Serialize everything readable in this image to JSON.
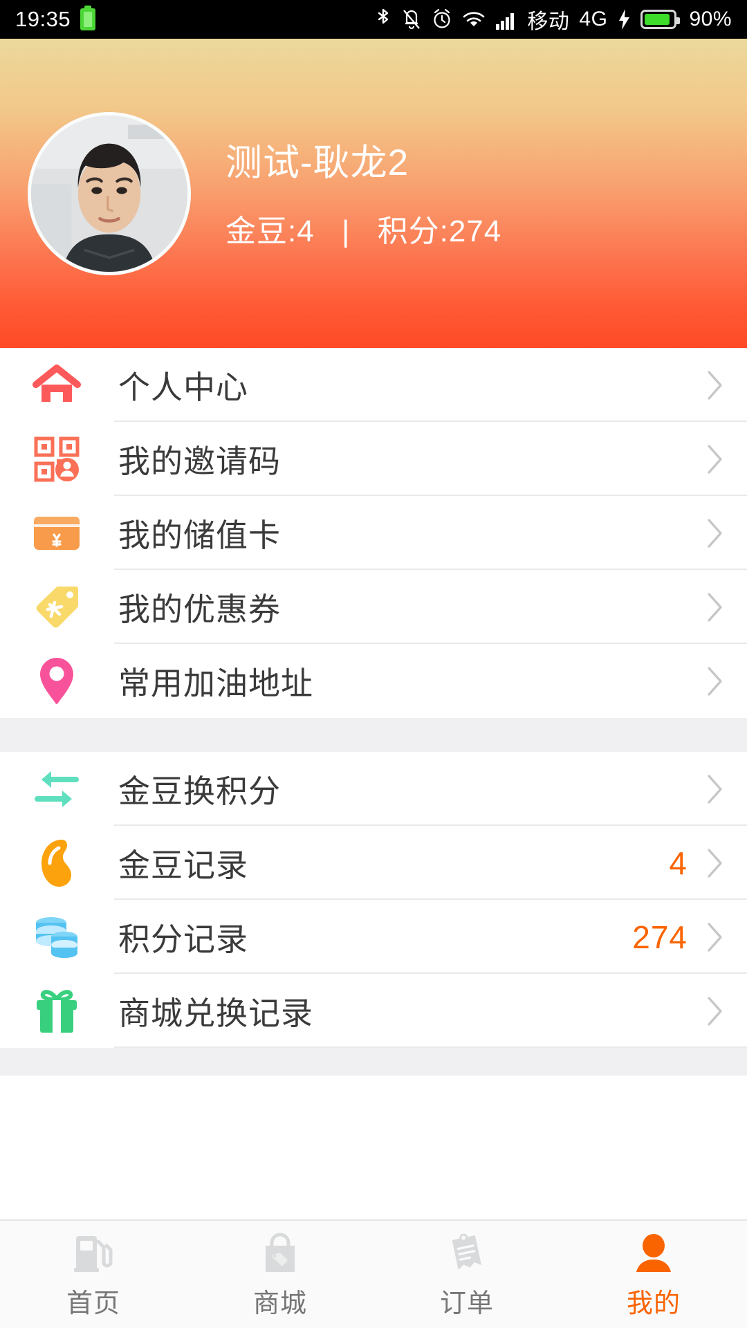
{
  "status_bar": {
    "time": "19:35",
    "carrier": "移动",
    "network": "4G",
    "battery_percent": "90%",
    "icons": [
      "battery-small-icon",
      "bluetooth-icon",
      "mute-bell-icon",
      "alarm-icon",
      "wifi-icon",
      "signal-bars-icon",
      "charging-bolt-icon",
      "battery-icon"
    ]
  },
  "header": {
    "avatar_name": "user-avatar",
    "user_name": "测试-耿龙2",
    "bean_label": "金豆:4",
    "separator": "|",
    "points_label": "积分:274",
    "gradient_top": "#ecd89c",
    "gradient_bottom": "#ff4a26"
  },
  "menu": {
    "group1": [
      {
        "icon": "home-icon",
        "icon_color": "#fc5a5a",
        "label": "个人中心",
        "value": ""
      },
      {
        "icon": "qrcode-user-icon",
        "icon_color": "#fa7057",
        "label": "我的邀请码",
        "value": ""
      },
      {
        "icon": "prepaid-card-icon",
        "icon_color": "#f89b4a",
        "label": "我的储值卡",
        "value": ""
      },
      {
        "icon": "coupon-tag-icon",
        "icon_color": "#f7d köp",
        "label": "我的优惠券",
        "value": ""
      },
      {
        "icon": "location-pin-icon",
        "icon_color": "#f8539a",
        "label": "常用加油地址",
        "value": ""
      }
    ],
    "group2": [
      {
        "icon": "exchange-arrows-icon",
        "icon_color": "#5fdfbe",
        "label": "金豆换积分",
        "value": ""
      },
      {
        "icon": "bean-icon",
        "icon_color": "#fca20c",
        "label": "金豆记录",
        "value": "4"
      },
      {
        "icon": "coin-stack-icon",
        "icon_color": "#54c3f2",
        "label": "积分记录",
        "value": "274"
      },
      {
        "icon": "gift-box-icon",
        "icon_color": "#38d07f",
        "label": "商城兑换记录",
        "value": ""
      }
    ],
    "chevron_icon": "chevron-right-icon",
    "value_color": "#fa6400"
  },
  "tabbar": {
    "active_color": "#fa6400",
    "inactive_color": "#767676",
    "items": [
      {
        "icon": "fuel-pump-icon",
        "label": "首页",
        "active": false
      },
      {
        "icon": "shopping-bag-icon",
        "label": "商城",
        "active": false
      },
      {
        "icon": "order-list-icon",
        "label": "订单",
        "active": false
      },
      {
        "icon": "person-icon",
        "label": "我的",
        "active": true
      }
    ]
  }
}
